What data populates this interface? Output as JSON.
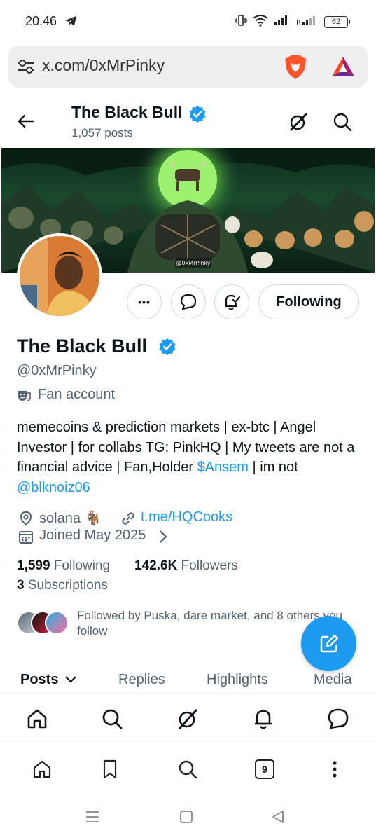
{
  "status_bar": {
    "time": "20.46",
    "battery": "62"
  },
  "browser": {
    "url": "x.com/0xMrPinky",
    "tab_count": "9"
  },
  "header": {
    "name": "The Black Bull",
    "posts_count": "1,057 posts"
  },
  "banner": {
    "watermark": "@0xMrPinky"
  },
  "actions": {
    "more": "•••",
    "following_label": "Following"
  },
  "profile": {
    "name": "The Black Bull",
    "handle": "@0xMrPinky",
    "category": "Fan account",
    "bio_text": "memecoins & prediction markets | ex-btc | Angel Investor | for collabs TG: PinkHQ | My tweets are not a financial advice | Fan,Holder ",
    "bio_cashtag": "$Ansem",
    "bio_middle": " | im not ",
    "bio_mention": "@blknoiz06",
    "location": "solana 🐐",
    "website": "t.me/HQCooks",
    "joined": "Joined May 2025"
  },
  "stats": {
    "following_num": "1,599",
    "following_label": " Following",
    "followers_num": "142.6K",
    "followers_label": " Followers",
    "subscriptions_num": "3",
    "subscriptions_label": " Subscriptions"
  },
  "followed_by": {
    "text": "Followed by Puska, dare market, and 8 others you follow"
  },
  "tabs": {
    "posts": "Posts",
    "replies": "Replies",
    "highlights": "Highlights",
    "media": "Media"
  },
  "colors": {
    "accent": "#1d9bf0",
    "text_primary": "#0f1419",
    "text_secondary": "#536471"
  }
}
